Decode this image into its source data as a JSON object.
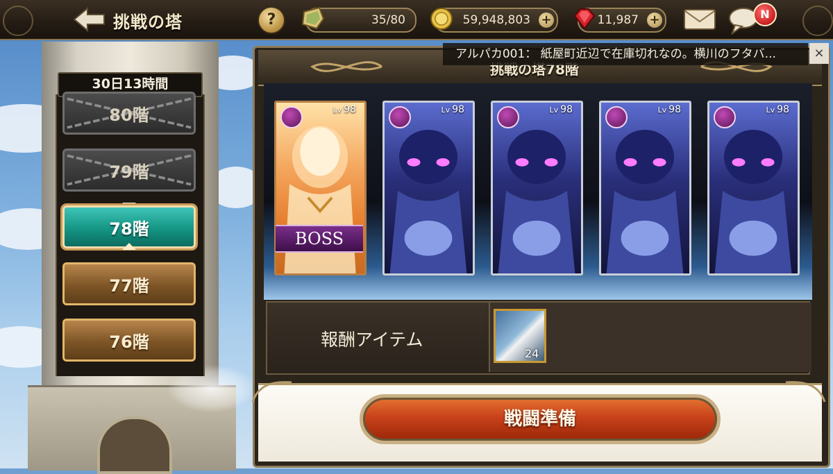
{
  "header": {
    "title": "挑戦の塔",
    "help": "?",
    "stamina": "35/80",
    "gold": "59,948,803",
    "gems": "11,987",
    "plus": "+",
    "notify_badge": "N"
  },
  "chat": {
    "message": "アルパカ001： 紙屋町近辺で在庫切れなの。横川のフタバ...",
    "close": "×"
  },
  "tower": {
    "timer": "30日13時間",
    "floors": [
      {
        "label": "80階",
        "state": "locked"
      },
      {
        "label": "79階",
        "state": "locked"
      },
      {
        "label": "78階",
        "state": "selected"
      },
      {
        "label": "77階",
        "state": "cleared"
      },
      {
        "label": "76階",
        "state": "cleared"
      }
    ]
  },
  "panel": {
    "title": "挑戦の塔78階",
    "enemies": [
      {
        "lv_prefix": "Lv",
        "level": "98",
        "boss": true
      },
      {
        "lv_prefix": "Lv",
        "level": "98",
        "boss": false
      },
      {
        "lv_prefix": "Lv",
        "level": "98",
        "boss": false
      },
      {
        "lv_prefix": "Lv",
        "level": "98",
        "boss": false
      },
      {
        "lv_prefix": "Lv",
        "level": "98",
        "boss": false
      }
    ],
    "boss_label": "BOSS",
    "reward_label": "報酬アイテム",
    "reward_count": "24",
    "battle_button": "戦闘準備"
  },
  "colors": {
    "accent_gold": "#c89a33",
    "selected_floor": "#149584",
    "battle_button": "#c9421b"
  },
  "icons": [
    "back-arrow-icon",
    "help-icon",
    "stamina-crystal-icon",
    "gold-coin-icon",
    "red-gem-icon",
    "mail-icon",
    "chat-bubble-icon",
    "attack-swords-icon"
  ]
}
